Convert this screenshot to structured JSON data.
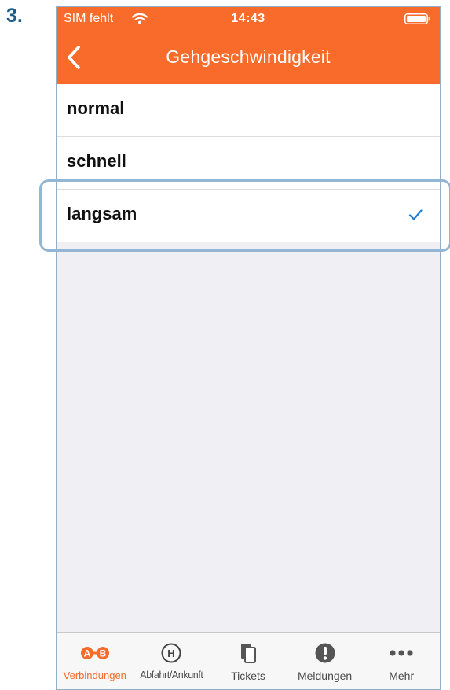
{
  "step_label": "3.",
  "status": {
    "carrier": "SIM fehlt",
    "time": "14:43"
  },
  "nav": {
    "title": "Gehgeschwindigkeit",
    "back_icon": "chevron-left-icon"
  },
  "options": [
    {
      "label": "normal",
      "selected": false
    },
    {
      "label": "schnell",
      "selected": false
    },
    {
      "label": "langsam",
      "selected": true
    }
  ],
  "tabs": [
    {
      "label": "Verbindungen",
      "icon": "a-to-b-icon",
      "active": true
    },
    {
      "label": "Abfahrt/Ankunft",
      "icon": "stop-h-icon",
      "active": false
    },
    {
      "label": "Tickets",
      "icon": "tickets-icon",
      "active": false
    },
    {
      "label": "Meldungen",
      "icon": "alert-icon",
      "active": false
    },
    {
      "label": "Mehr",
      "icon": "more-dots-icon",
      "active": false
    }
  ],
  "colors": {
    "brand": "#f86b2a",
    "check": "#1a7fd4",
    "highlight": "#93b6d4",
    "step_number": "#1f5c87"
  }
}
